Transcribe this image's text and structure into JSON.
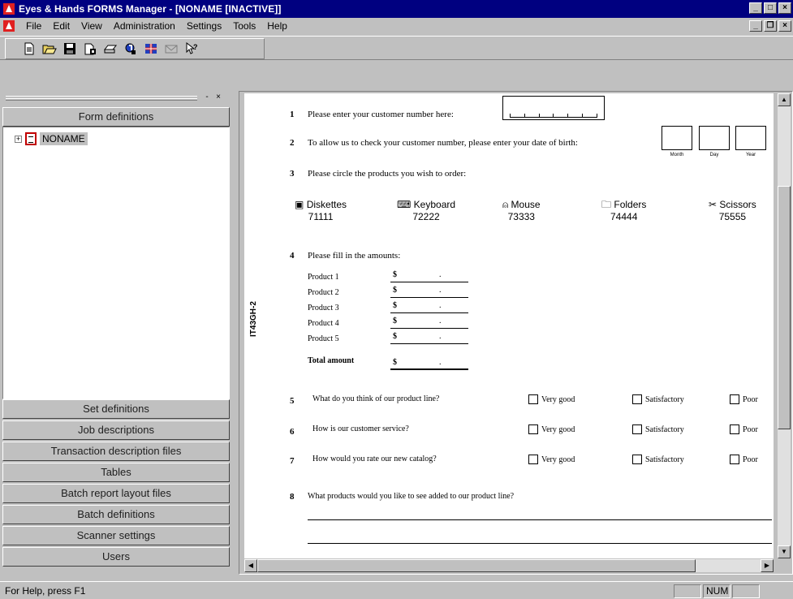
{
  "window": {
    "title": "Eyes & Hands FORMS Manager - [NONAME [INACTIVE]]",
    "minimize": "_",
    "maximize": "□",
    "close": "×",
    "doc_minimize": "_",
    "doc_restore": "❐",
    "doc_close": "×"
  },
  "menu": {
    "items": [
      "File",
      "Edit",
      "View",
      "Administration",
      "Settings",
      "Tools",
      "Help"
    ]
  },
  "toolbar": {
    "icons": [
      "new-icon",
      "open-icon",
      "save-icon",
      "properties-icon",
      "print-icon",
      "scan-icon",
      "flag-icon",
      "mail-icon",
      "help-pointer-icon"
    ]
  },
  "leftpanel": {
    "pin": "-",
    "close": "×",
    "sections_top": [
      "Form definitions"
    ],
    "tree_item": "NONAME",
    "tree_expand": "+",
    "sections_bottom": [
      "Set definitions",
      "Job descriptions",
      "Transaction description files",
      "Tables",
      "Batch report layout files",
      "Batch definitions",
      "Scanner settings",
      "Users"
    ]
  },
  "form": {
    "side_code": "IT43GH-2",
    "q1": {
      "num": "1",
      "text": "Please enter your customer number here:"
    },
    "q2": {
      "num": "2",
      "text": "To allow us to check your customer number, please enter your date of birth:",
      "labels": [
        "Month",
        "Day",
        "Year"
      ]
    },
    "q3": {
      "num": "3",
      "text": "Please circle the products you wish to order:"
    },
    "products": [
      {
        "icon": "diskette-icon",
        "glyph": "▣",
        "name": "Diskettes",
        "code": "71111"
      },
      {
        "icon": "keyboard-icon",
        "glyph": "⌨",
        "name": "Keyboard",
        "code": "72222"
      },
      {
        "icon": "mouse-icon",
        "glyph": "⍝",
        "name": "Mouse",
        "code": "73333"
      },
      {
        "icon": "folder-icon",
        "glyph": "🗀",
        "name": "Folders",
        "code": "74444"
      },
      {
        "icon": "scissors-icon",
        "glyph": "✂",
        "name": "Scissors",
        "code": "75555"
      }
    ],
    "q4": {
      "num": "4",
      "text": "Please fill in the amounts:"
    },
    "amounts": [
      {
        "label": "Product 1",
        "currency": "$",
        "sep": "."
      },
      {
        "label": "Product 2",
        "currency": "$",
        "sep": "."
      },
      {
        "label": "Product 3",
        "currency": "$",
        "sep": "."
      },
      {
        "label": "Product 4",
        "currency": "$",
        "sep": "."
      },
      {
        "label": "Product 5",
        "currency": "$",
        "sep": "."
      }
    ],
    "total": {
      "label": "Total amount",
      "currency": "$",
      "sep": "."
    },
    "ratings": [
      {
        "num": "5",
        "text": "What do you think of our product line?"
      },
      {
        "num": "6",
        "text": "How is our customer service?"
      },
      {
        "num": "7",
        "text": "How would you rate our new catalog?"
      }
    ],
    "rating_options": [
      "Very good",
      "Satisfactory",
      "Poor"
    ],
    "q8": {
      "num": "8",
      "text": "What products would you like to see added to our product line?"
    }
  },
  "status": {
    "help": "For Help, press F1",
    "num": "NUM"
  }
}
